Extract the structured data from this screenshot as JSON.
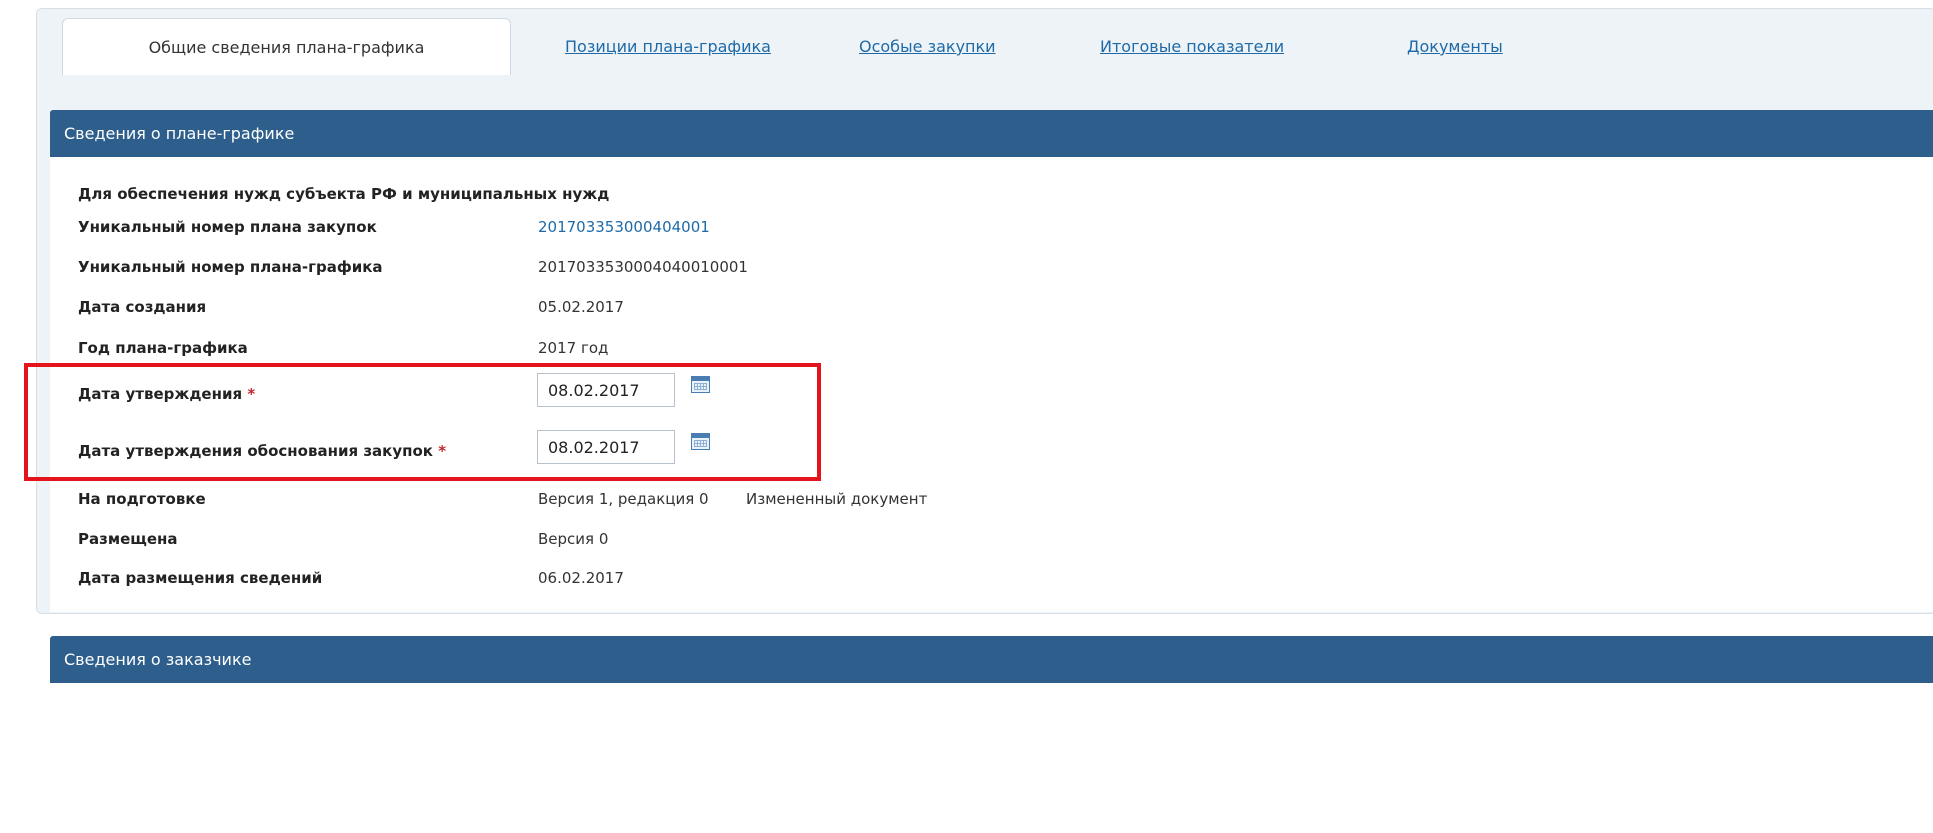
{
  "tabs": {
    "active": "Общие сведения плана-графика",
    "links": [
      "Позиции плана-графика",
      "Особые закупки",
      "Итоговые показатели",
      "Документы"
    ]
  },
  "section1": {
    "title": "Сведения о плане-графике",
    "subtitle": "Для обеспечения нужд субъекта РФ и муниципальных нужд",
    "rows": {
      "plan_number_label": "Уникальный номер плана закупок",
      "plan_number_value": "201703353000404001",
      "schedule_number_label": "Уникальный номер плана-графика",
      "schedule_number_value": "2017033530004040010001",
      "created_label": "Дата создания",
      "created_value": "05.02.2017",
      "year_label": "Год плана-графика",
      "year_value": "2017 год",
      "approval_label": "Дата утверждения",
      "approval_value": "08.02.2017",
      "justification_label": "Дата утверждения обоснования закупок",
      "justification_value": "08.02.2017",
      "required_mark": "*",
      "prep_label": "На подготовке",
      "prep_value": "Версия 1, редакция 0",
      "prep_note": "Измененный документ",
      "placed_label": "Размещена",
      "placed_value": "Версия 0",
      "placed_date_label": "Дата размещения сведений",
      "placed_date_value": "06.02.2017"
    }
  },
  "section2": {
    "title": "Сведения о заказчике"
  },
  "colors": {
    "header": "#2e5f8c",
    "link": "#1e6aa8",
    "highlight": "#e3141c",
    "required": "#c0282d"
  }
}
